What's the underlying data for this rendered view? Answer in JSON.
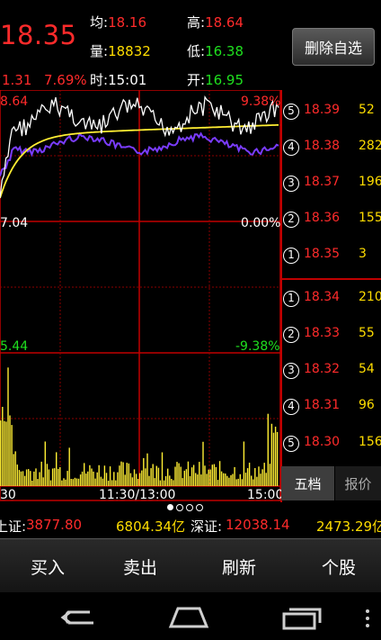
{
  "header": {
    "price": "18.35",
    "change": "1.31",
    "change_pct": "7.69%",
    "avg_label": "均:",
    "avg_value": "18.16",
    "volume_label": "量:",
    "volume_value": "18832",
    "time_label": "时:",
    "time_value": "15:01",
    "high_label": "高:",
    "high_value": "18.64",
    "low_label": "低:",
    "low_value": "16.38",
    "open_label": "开:",
    "open_value": "16.95",
    "remove_button": "删除自选"
  },
  "chart": {
    "top_left_price": "8.64",
    "top_right_pct": "9.38%",
    "mid_left_price": "7.04",
    "mid_right_pct": "0.00%",
    "low_left_price": "5.44",
    "low_right_pct": "-9.38%",
    "time_start": "30",
    "time_mid": "11:30/13:00",
    "time_end": "15:00"
  },
  "order_book": {
    "sell": [
      {
        "num": "5",
        "price": "18.39",
        "vol": "52"
      },
      {
        "num": "4",
        "price": "18.38",
        "vol": "282"
      },
      {
        "num": "3",
        "price": "18.37",
        "vol": "196"
      },
      {
        "num": "2",
        "price": "18.36",
        "vol": "155"
      },
      {
        "num": "1",
        "price": "18.35",
        "vol": "3"
      }
    ],
    "buy": [
      {
        "num": "1",
        "price": "18.34",
        "vol": "210"
      },
      {
        "num": "2",
        "price": "18.33",
        "vol": "55"
      },
      {
        "num": "3",
        "price": "18.32",
        "vol": "54"
      },
      {
        "num": "4",
        "price": "18.31",
        "vol": "96"
      },
      {
        "num": "5",
        "price": "18.30",
        "vol": "156"
      }
    ],
    "tab_active": "五档",
    "tab_other": "报价"
  },
  "ticker": {
    "sh_label": "上证:",
    "sh_value": "3877.80",
    "sh_amount": "6804.34亿",
    "sz_label": "深证:",
    "sz_value": "12038.14",
    "sz_amount": "2473.29亿"
  },
  "actions": {
    "buy": "买入",
    "sell": "卖出",
    "refresh": "刷新",
    "stock": "个股"
  },
  "colors": {
    "up": "#ff2b2b",
    "down": "#1fe01f",
    "volume": "#ffdd00",
    "grid": "#c00000",
    "price_line": "#ffffff",
    "avg_line": "#ffee33",
    "purple_line": "#7a3cff"
  }
}
